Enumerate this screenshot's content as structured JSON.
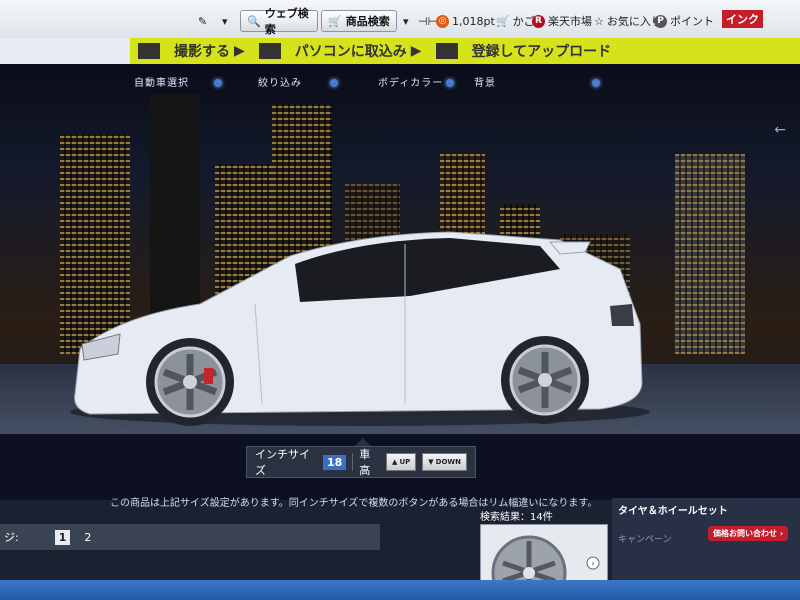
{
  "toolbar": {
    "web_search_label": "ウェブ検索",
    "product_search_label": "商品検索",
    "points_label": "1,018pt",
    "cart_label": "かご",
    "rakuten_label": "楽天市場",
    "favorites_label": "お気に入り",
    "point_label": "ポイント",
    "right_label": "インク"
  },
  "banner": {
    "item1": "撮影する",
    "item2": "パソコンに取込み",
    "item3": "登録してアップロード"
  },
  "tabs": [
    "自動車選択",
    "絞り込み",
    "ボディカラー",
    "背景"
  ],
  "controls": {
    "inch_label": "インチサイズ",
    "inch_value": "18",
    "height_label": "車高",
    "up_label": "UP",
    "down_label": "DOWN"
  },
  "notice": "この商品は上記サイズ設定があります。同インチサイズで複数のボタンがある場合はリム幅違いになります。",
  "pagination": {
    "prefix": "ジ:",
    "pages": [
      "1",
      "2"
    ],
    "current": "1"
  },
  "results": {
    "label": "検索結果：14件"
  },
  "side_panel": {
    "title": "タイヤ＆ホイールセット",
    "subtitle": "キャンペーン",
    "badge": "価格お問い合わせ"
  },
  "colors": {
    "banner": "#d6e21a",
    "accent": "#3b6fc2",
    "car": "#e8ecf4",
    "badge": "#c21d2d"
  }
}
